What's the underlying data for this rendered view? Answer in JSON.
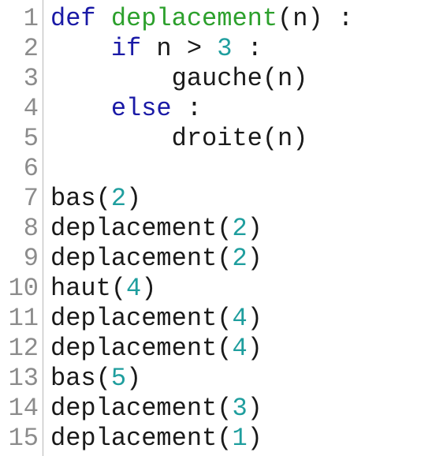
{
  "lines": [
    {
      "number": "1",
      "tokens": [
        {
          "text": "def",
          "kind": "kw"
        },
        {
          "text": " ",
          "kind": "plain"
        },
        {
          "text": "deplacement",
          "kind": "fn"
        },
        {
          "text": "(n) :",
          "kind": "plain"
        }
      ]
    },
    {
      "number": "2",
      "tokens": [
        {
          "text": "    ",
          "kind": "plain"
        },
        {
          "text": "if",
          "kind": "kw"
        },
        {
          "text": " n > ",
          "kind": "plain"
        },
        {
          "text": "3",
          "kind": "num"
        },
        {
          "text": " :",
          "kind": "plain"
        }
      ]
    },
    {
      "number": "3",
      "tokens": [
        {
          "text": "        gauche(n)",
          "kind": "plain"
        }
      ]
    },
    {
      "number": "4",
      "tokens": [
        {
          "text": "    ",
          "kind": "plain"
        },
        {
          "text": "else",
          "kind": "kw"
        },
        {
          "text": " :",
          "kind": "plain"
        }
      ]
    },
    {
      "number": "5",
      "tokens": [
        {
          "text": "        droite(n)",
          "kind": "plain"
        }
      ]
    },
    {
      "number": "6",
      "tokens": []
    },
    {
      "number": "7",
      "tokens": [
        {
          "text": "bas(",
          "kind": "plain"
        },
        {
          "text": "2",
          "kind": "num"
        },
        {
          "text": ")",
          "kind": "plain"
        }
      ]
    },
    {
      "number": "8",
      "tokens": [
        {
          "text": "deplacement(",
          "kind": "plain"
        },
        {
          "text": "2",
          "kind": "num"
        },
        {
          "text": ")",
          "kind": "plain"
        }
      ]
    },
    {
      "number": "9",
      "tokens": [
        {
          "text": "deplacement(",
          "kind": "plain"
        },
        {
          "text": "2",
          "kind": "num"
        },
        {
          "text": ")",
          "kind": "plain"
        }
      ]
    },
    {
      "number": "10",
      "tokens": [
        {
          "text": "haut(",
          "kind": "plain"
        },
        {
          "text": "4",
          "kind": "num"
        },
        {
          "text": ")",
          "kind": "plain"
        }
      ]
    },
    {
      "number": "11",
      "tokens": [
        {
          "text": "deplacement(",
          "kind": "plain"
        },
        {
          "text": "4",
          "kind": "num"
        },
        {
          "text": ")",
          "kind": "plain"
        }
      ]
    },
    {
      "number": "12",
      "tokens": [
        {
          "text": "deplacement(",
          "kind": "plain"
        },
        {
          "text": "4",
          "kind": "num"
        },
        {
          "text": ")",
          "kind": "plain"
        }
      ]
    },
    {
      "number": "13",
      "tokens": [
        {
          "text": "bas(",
          "kind": "plain"
        },
        {
          "text": "5",
          "kind": "num"
        },
        {
          "text": ")",
          "kind": "plain"
        }
      ]
    },
    {
      "number": "14",
      "tokens": [
        {
          "text": "deplacement(",
          "kind": "plain"
        },
        {
          "text": "3",
          "kind": "num"
        },
        {
          "text": ")",
          "kind": "plain"
        }
      ]
    },
    {
      "number": "15",
      "tokens": [
        {
          "text": "deplacement(",
          "kind": "plain"
        },
        {
          "text": "1",
          "kind": "num"
        },
        {
          "text": ")",
          "kind": "plain"
        }
      ]
    }
  ],
  "colors": {
    "keyword": "#1a1aa6",
    "function_name": "#2ca02c",
    "number": "#1f9e9e",
    "text": "#1a1a1a",
    "line_number": "#8c8c8c",
    "gutter_border": "#b8b8b8",
    "background": "#ffffff"
  }
}
